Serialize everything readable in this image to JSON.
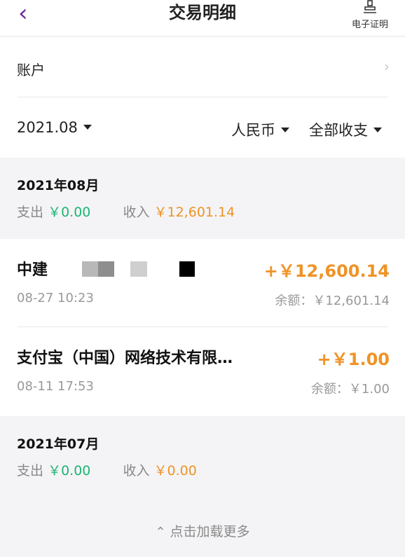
{
  "header": {
    "title": "交易明细",
    "back_icon": "chevron-left-icon",
    "certificate_label": "电子证明",
    "certificate_icon": "stamp-icon",
    "accent_color": "#6a2a9c"
  },
  "account": {
    "label": "账户"
  },
  "filters": {
    "date": "2021.08",
    "currency": "人民币",
    "type": "全部收支"
  },
  "months": [
    {
      "title": "2021年08月",
      "expense_label": "支出",
      "expense_value": "￥0.00",
      "income_label": "收入",
      "income_value": "￥12,601.14"
    },
    {
      "title": "2021年07月",
      "expense_label": "支出",
      "expense_value": "￥0.00",
      "income_label": "收入",
      "income_value": "￥0.00"
    }
  ],
  "transactions": [
    {
      "name": "中建",
      "amount": "+￥12,600.14",
      "time": "08-27 10:23",
      "balance": "余额：￥12,601.14"
    },
    {
      "name": "支付宝（中国）网络技术有限…",
      "amount": "+￥1.00",
      "time": "08-11 17:53",
      "balance": "余额：￥1.00"
    }
  ],
  "load_more": {
    "label": "点击加载更多",
    "icon": "chevron-up-icon"
  },
  "colors": {
    "expense": "#1db573",
    "income": "#ef9326"
  }
}
